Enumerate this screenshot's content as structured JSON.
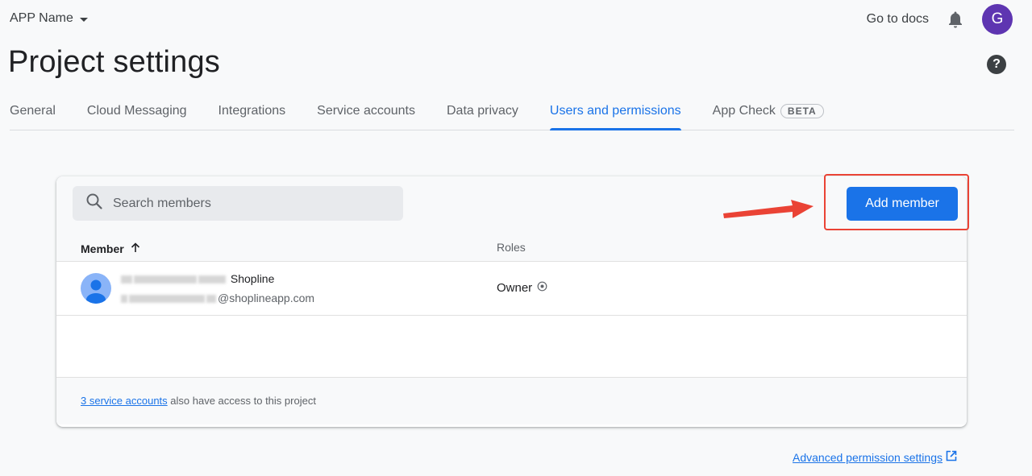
{
  "header": {
    "app_name": "APP Name",
    "docs_label": "Go to docs",
    "avatar_initial": "G",
    "avatar_color": "#5e35b1"
  },
  "page": {
    "title": "Project settings"
  },
  "tabs": [
    {
      "label": "General",
      "active": false
    },
    {
      "label": "Cloud Messaging",
      "active": false
    },
    {
      "label": "Integrations",
      "active": false
    },
    {
      "label": "Service accounts",
      "active": false
    },
    {
      "label": "Data privacy",
      "active": false
    },
    {
      "label": "Users and permissions",
      "active": true
    },
    {
      "label": "App Check",
      "badge": "BETA",
      "active": false
    }
  ],
  "members_card": {
    "search_placeholder": "Search members",
    "add_button_label": "Add member",
    "columns": {
      "member": "Member",
      "roles": "Roles"
    },
    "rows": [
      {
        "name_visible": "Shopline",
        "email_visible": "@shoplineapp.com",
        "role": "Owner"
      }
    ],
    "footer": {
      "link_text": "3 service accounts",
      "text": " also have access to this project"
    }
  },
  "advanced_link": "Advanced permission settings",
  "colors": {
    "accent": "#1a73e8",
    "annotation": "#ea4335"
  }
}
